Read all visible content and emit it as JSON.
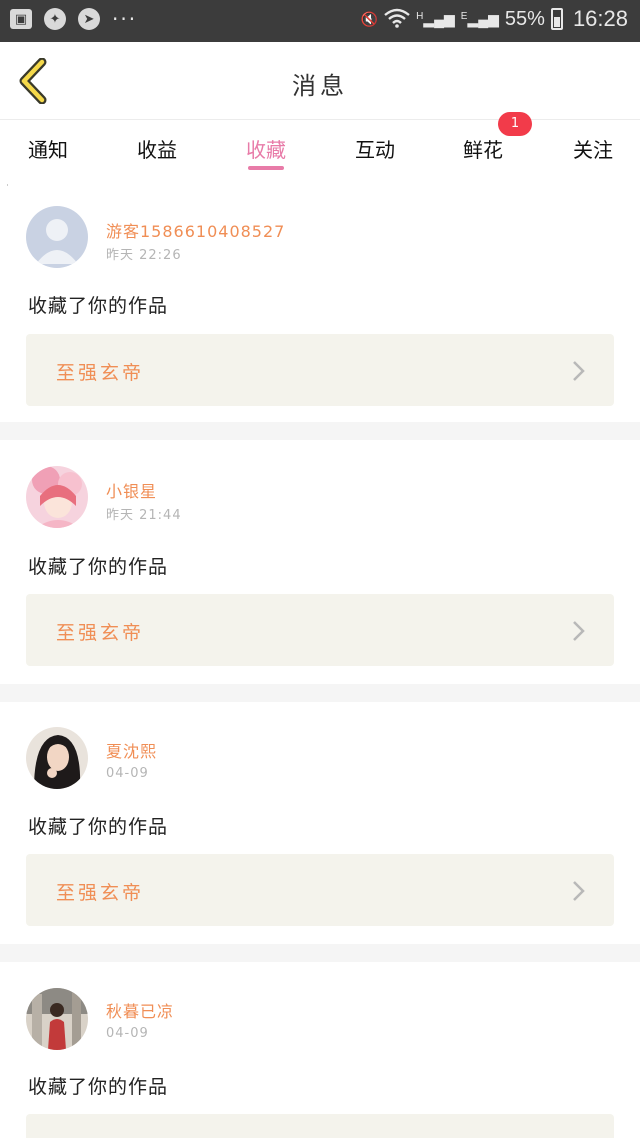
{
  "status_bar": {
    "dots": "···",
    "signal_h": "H",
    "signal_e": "E",
    "battery": "55%",
    "time": "16:28"
  },
  "header": {
    "title": "消息",
    "back_icon": "chevron-left-icon"
  },
  "tabs": [
    {
      "label": "通知",
      "active": false
    },
    {
      "label": "收益",
      "active": false
    },
    {
      "label": "收藏",
      "active": true
    },
    {
      "label": "互动",
      "active": false
    },
    {
      "label": "鲜花",
      "active": false,
      "badge": "1"
    },
    {
      "label": "关注",
      "active": false
    }
  ],
  "colors": {
    "accent_pink": "#e87ba8",
    "name_orange": "#f08e55",
    "badge_red": "#f23b4a",
    "work_bg": "#f4f3ec"
  },
  "messages": [
    {
      "name": "游客15866104085​27",
      "time": "昨天 22:26",
      "action": "收藏了你的作品",
      "work": "至强玄帝",
      "avatar": "default-avatar"
    },
    {
      "name": "小银星",
      "time": "昨天 21:44",
      "action": "收藏了你的作品",
      "work": "至强玄帝",
      "avatar": "anime-girl-avatar"
    },
    {
      "name": "夏沈熙",
      "time": "04-09",
      "action": "收藏了你的作品",
      "work": "至强玄帝",
      "avatar": "photo-avatar"
    },
    {
      "name": "秋暮已凉",
      "time": "04-09",
      "action": "收藏了你的作品",
      "work": "",
      "avatar": "photo-avatar"
    }
  ]
}
